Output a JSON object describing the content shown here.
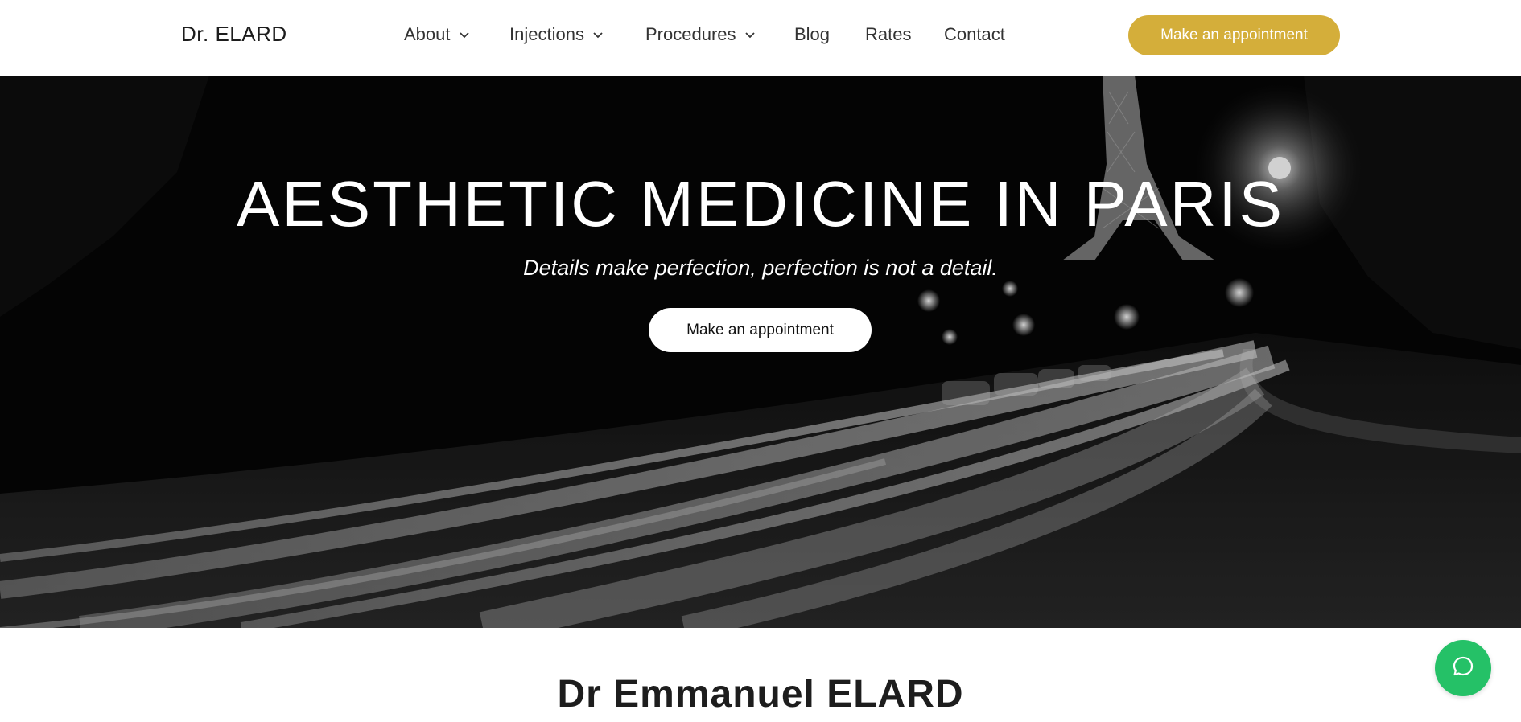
{
  "header": {
    "logo": "Dr. ELARD",
    "nav": [
      {
        "label": "About",
        "has_dropdown": true
      },
      {
        "label": "Injections",
        "has_dropdown": true
      },
      {
        "label": "Procedures",
        "has_dropdown": true
      },
      {
        "label": "Blog",
        "has_dropdown": false
      },
      {
        "label": "Rates",
        "has_dropdown": false
      },
      {
        "label": "Contact",
        "has_dropdown": false
      }
    ],
    "cta_label": "Make an appointment"
  },
  "hero": {
    "title": "AESTHETIC MEDICINE IN PARIS",
    "subtitle": "Details make perfection, perfection is not a detail.",
    "cta_label": "Make an appointment"
  },
  "main": {
    "doctor_name": "Dr Emmanuel ELARD"
  },
  "colors": {
    "accent_gold": "#d4ae3a",
    "chat_green": "#25c167",
    "hero_bg": "#070707"
  },
  "icons": {
    "nav_dropdown": "chevron-down-icon",
    "chat": "chat-bubble-icon"
  }
}
